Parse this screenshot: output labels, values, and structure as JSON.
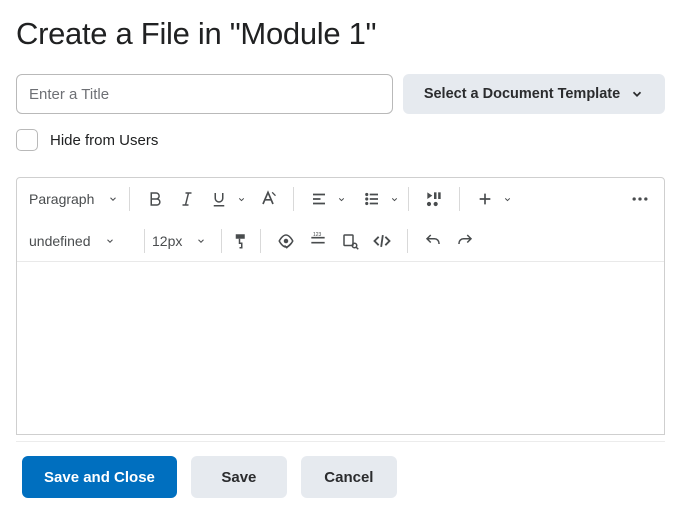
{
  "page": {
    "title": "Create a File in \"Module 1\""
  },
  "title_row": {
    "placeholder": "Enter a Title",
    "value": "",
    "template_button": "Select a Document Template"
  },
  "hide_users": {
    "label": "Hide from Users",
    "checked": false
  },
  "toolbar": {
    "paragraph": "Paragraph",
    "font_family": "undefined",
    "font_size": "12px"
  },
  "footer": {
    "save_close": "Save and Close",
    "save": "Save",
    "cancel": "Cancel"
  }
}
